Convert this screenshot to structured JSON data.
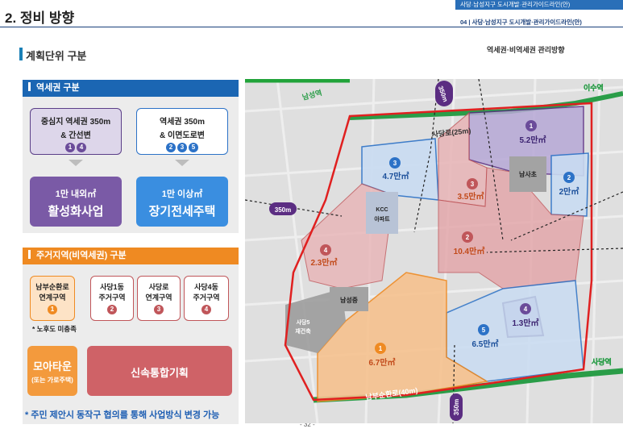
{
  "header": {
    "section_title": "2. 정비 방향",
    "doc_title_top": "사당·남성지구 도시개발·관리가이드라인(안)",
    "doc_title_bottom": "04 | 사당·남성지구 도시개발·관리가이드라인(안)"
  },
  "plan": {
    "title": "계획단위 구분",
    "map_caption": "역세권·비역세권 관리방향"
  },
  "station_panel": {
    "title": "역세권 구분",
    "box_a_line1": "중심지 역세권 350m",
    "box_a_line2": "& 간선변",
    "box_a_nums": [
      "1",
      "4"
    ],
    "box_b_line1": "역세권 350m",
    "box_b_line2": "& 이면도로변",
    "box_b_nums": [
      "2",
      "3",
      "5"
    ],
    "result_a_line1": "1만 내외㎡",
    "result_a_line2": "활성화사업",
    "result_b_line1": "1만 이상㎡",
    "result_b_line2": "장기전세주택"
  },
  "residential_panel": {
    "title": "주거지역(비역세권) 구분",
    "areas": [
      {
        "line1": "남부순환로",
        "line2": "연계구역",
        "num": "1"
      },
      {
        "line1": "사당1동",
        "line2": "주거구역",
        "num": "2"
      },
      {
        "line1": "사당로",
        "line2": "연계구역",
        "num": "3"
      },
      {
        "line1": "사당4동",
        "line2": "주거구역",
        "num": "4"
      }
    ],
    "note": "* 노후도 미충족",
    "moa_line1": "모아타운",
    "moa_line2": "(또는 가로주택)",
    "fast_track": "신속통합기획"
  },
  "footnote": "* 주민 제안시 동작구 협의를 통해 사업방식 변경 가능",
  "page_number": "- 32 -",
  "map": {
    "station_namseong": "남성역",
    "station_isu": "이수역",
    "station_sadang": "사당역",
    "road_sadang": "사당로(25m)",
    "road_nambu": "남부순환로(40m)",
    "radius_label": "350m",
    "school_namsa": "남사초",
    "school_namseong": "남성중",
    "apt_kcc_1": "KCC",
    "apt_kcc_2": "아파트",
    "recon_1": "사당5",
    "recon_2": "재건축",
    "zones": [
      {
        "num": "1",
        "area": "5.2만㎡"
      },
      {
        "num": "2",
        "area": "2만㎡"
      },
      {
        "num": "3",
        "area": "4.7만㎡"
      },
      {
        "num": "3",
        "area": "3.5만㎡"
      },
      {
        "num": "2",
        "area": "10.4만㎡"
      },
      {
        "num": "4",
        "area": "2.3만㎡"
      },
      {
        "num": "4",
        "area": "1.3만㎡"
      },
      {
        "num": "5",
        "area": "6.5만㎡"
      },
      {
        "num": "1",
        "area": "6.7만㎡"
      }
    ]
  },
  "colors": {
    "blue_dark": "#1b66b3",
    "orange": "#ef8a22",
    "purple": "#5b2d82",
    "red_outline": "#e02020",
    "lavender": "#7b5aa6",
    "blue_light": "#3a8ee0",
    "rose": "#c0565a"
  }
}
